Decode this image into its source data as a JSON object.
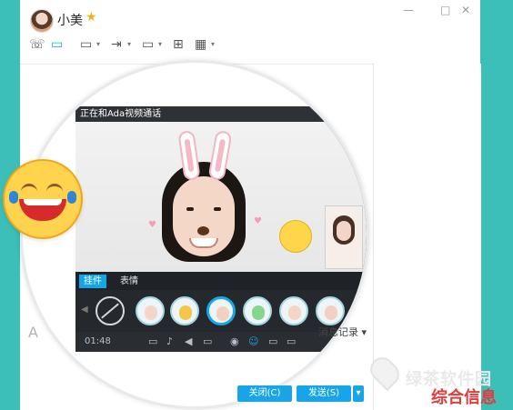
{
  "header": {
    "contact_name": "小美",
    "star_icon": "star-icon"
  },
  "window_controls": {
    "minimize": "—",
    "maximize": "□",
    "close": "✕"
  },
  "toolbar": {
    "items": [
      {
        "name": "phone-icon",
        "glyph": "☏"
      },
      {
        "name": "video-call-icon",
        "glyph": "▭"
      },
      {
        "name": "share-screen-icon",
        "glyph": "▭"
      },
      {
        "name": "transfer-file-icon",
        "glyph": "⇥"
      },
      {
        "name": "remote-desktop-icon",
        "glyph": "▭"
      },
      {
        "name": "add-plus-icon",
        "glyph": "⊞"
      },
      {
        "name": "apps-grid-icon",
        "glyph": "▦"
      }
    ],
    "caret_glyph": "▾"
  },
  "video_panel": {
    "title": "正在和Ada视频通话",
    "tabs": {
      "pendant": "挂件",
      "expression": "表情"
    },
    "timer": "01:48",
    "left_nav_glyph": "◀"
  },
  "input": {
    "font_letter": "A"
  },
  "actions": {
    "message_history": "消息记录",
    "close_button": "关闭(C)",
    "send_button": "发送(S)",
    "send_dropdown_glyph": "▾"
  },
  "watermark": {
    "brand": "绿茶软件园",
    "subtitle": "综合信息"
  },
  "colors": {
    "teal_background": "#3bbfb8",
    "accent_blue": "#17a5e8",
    "video_icon_active": "#12b7b0"
  }
}
